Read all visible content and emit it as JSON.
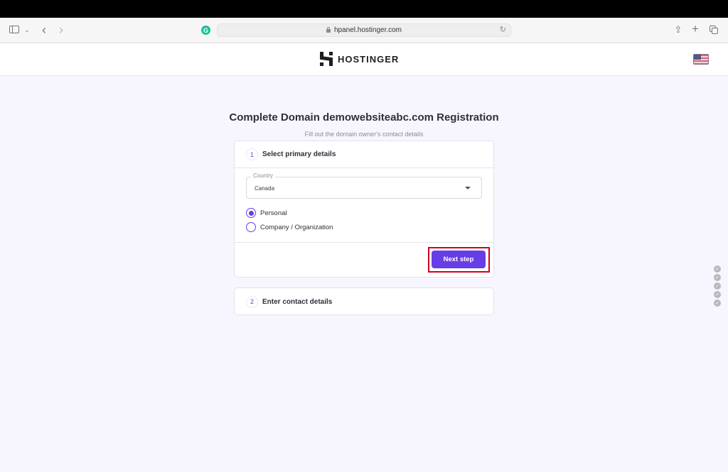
{
  "browser": {
    "url": "hpanel.hostinger.com",
    "icons": {
      "sidebar": "sidebar-toggle-icon",
      "back": "‹",
      "forward": "›",
      "chevron": "⌄",
      "grammarly": "G",
      "reload": "↻",
      "share": "⇪",
      "new_tab": "+"
    }
  },
  "header": {
    "brand": "HOSTINGER",
    "language_flag": "us-flag"
  },
  "page": {
    "title": "Complete Domain demowebsiteabc.com Registration",
    "subtitle": "Fill out the domain owner's contact details"
  },
  "steps": [
    {
      "number": "1",
      "label": "Select primary details",
      "country_field": {
        "label": "Country",
        "value": "Canada"
      },
      "owner_type": {
        "options": [
          "Personal",
          "Company / Organization"
        ],
        "selected": "Personal"
      },
      "next_button": "Next step"
    },
    {
      "number": "2",
      "label": "Enter contact details"
    }
  ],
  "side_checks": [
    "✓",
    "✓",
    "✓",
    "✓",
    "✓"
  ],
  "colors": {
    "accent": "#673de6",
    "highlight": "#d1001f",
    "background": "#f7f6fe"
  }
}
